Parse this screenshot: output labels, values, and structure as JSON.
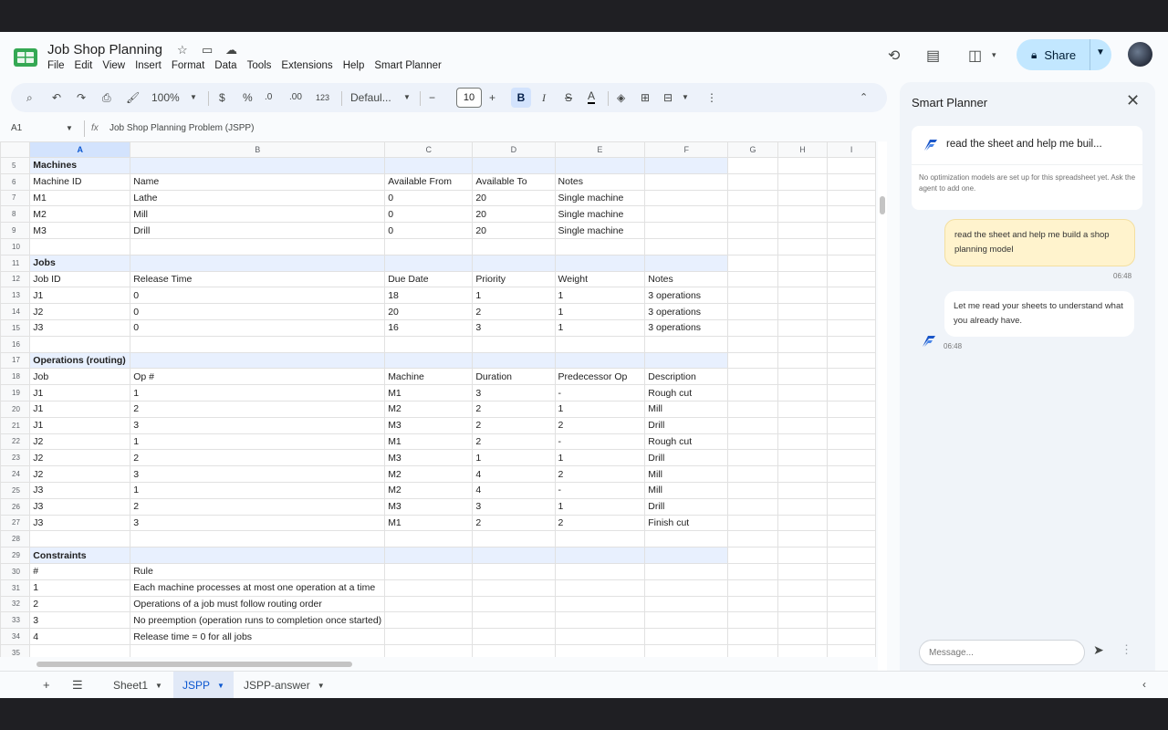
{
  "app": {
    "title": "Job Shop Planning",
    "menu": [
      "File",
      "Edit",
      "View",
      "Insert",
      "Format",
      "Data",
      "Tools",
      "Extensions",
      "Help",
      "Smart Planner"
    ],
    "share_label": "Share"
  },
  "toolbar": {
    "zoom": "100%",
    "currency": "$",
    "percent": "%",
    "dec_decrease": ".0",
    "dec_increase": ".00",
    "number_format": "123",
    "font": "Defaul...",
    "font_size": "10"
  },
  "formula_bar": {
    "cell_ref": "A1",
    "fx": "fx",
    "content": "Job Shop Planning Problem (JSPP)"
  },
  "grid": {
    "columns": [
      "A",
      "B",
      "C",
      "D",
      "E",
      "F",
      "G",
      "H",
      "I"
    ],
    "rows": [
      {
        "n": "5",
        "section": true,
        "cells": [
          "Machines",
          "",
          "",
          "",
          "",
          ""
        ]
      },
      {
        "n": "6",
        "cells": [
          "Machine ID",
          "Name",
          "Available From",
          "Available To",
          "Notes",
          ""
        ]
      },
      {
        "n": "7",
        "cells": [
          "M1",
          "Lathe",
          "0",
          "20",
          "Single machine",
          ""
        ]
      },
      {
        "n": "8",
        "cells": [
          "M2",
          "Mill",
          "0",
          "20",
          "Single machine",
          ""
        ]
      },
      {
        "n": "9",
        "cells": [
          "M3",
          "Drill",
          "0",
          "20",
          "Single machine",
          ""
        ]
      },
      {
        "n": "10",
        "cells": [
          "",
          "",
          "",
          "",
          "",
          ""
        ]
      },
      {
        "n": "11",
        "section": true,
        "cells": [
          "Jobs",
          "",
          "",
          "",
          "",
          ""
        ]
      },
      {
        "n": "12",
        "cells": [
          "Job ID",
          "Release Time",
          "Due Date",
          "Priority",
          "Weight",
          "Notes"
        ]
      },
      {
        "n": "13",
        "cells": [
          "J1",
          "0",
          "18",
          "1",
          "1",
          "3 operations"
        ]
      },
      {
        "n": "14",
        "cells": [
          "J2",
          "0",
          "20",
          "2",
          "1",
          "3 operations"
        ]
      },
      {
        "n": "15",
        "cells": [
          "J3",
          "0",
          "16",
          "3",
          "1",
          "3 operations"
        ]
      },
      {
        "n": "16",
        "cells": [
          "",
          "",
          "",
          "",
          "",
          ""
        ]
      },
      {
        "n": "17",
        "section": true,
        "cells": [
          "Operations (routing)",
          "",
          "",
          "",
          "",
          ""
        ]
      },
      {
        "n": "18",
        "cells": [
          "Job",
          "Op #",
          "Machine",
          "Duration",
          "Predecessor Op",
          "Description"
        ]
      },
      {
        "n": "19",
        "cells": [
          "J1",
          "1",
          "M1",
          "3",
          "-",
          "Rough cut"
        ]
      },
      {
        "n": "20",
        "cells": [
          "J1",
          "2",
          "M2",
          "2",
          "1",
          "Mill"
        ]
      },
      {
        "n": "21",
        "cells": [
          "J1",
          "3",
          "M3",
          "2",
          "2",
          "Drill"
        ]
      },
      {
        "n": "22",
        "cells": [
          "J2",
          "1",
          "M1",
          "2",
          "-",
          "Rough cut"
        ]
      },
      {
        "n": "23",
        "cells": [
          "J2",
          "2",
          "M3",
          "1",
          "1",
          "Drill"
        ]
      },
      {
        "n": "24",
        "cells": [
          "J2",
          "3",
          "M2",
          "4",
          "2",
          "Mill"
        ]
      },
      {
        "n": "25",
        "cells": [
          "J3",
          "1",
          "M2",
          "4",
          "-",
          "Mill"
        ]
      },
      {
        "n": "26",
        "cells": [
          "J3",
          "2",
          "M3",
          "3",
          "1",
          "Drill"
        ]
      },
      {
        "n": "27",
        "cells": [
          "J3",
          "3",
          "M1",
          "2",
          "2",
          "Finish cut"
        ]
      },
      {
        "n": "28",
        "cells": [
          "",
          "",
          "",
          "",
          "",
          ""
        ]
      },
      {
        "n": "29",
        "section": true,
        "cells": [
          "Constraints",
          "",
          "",
          "",
          "",
          ""
        ]
      },
      {
        "n": "30",
        "cells": [
          "#",
          "Rule",
          "",
          "",
          "",
          ""
        ]
      },
      {
        "n": "31",
        "cells": [
          "1",
          "Each machine processes at most one operation at a time",
          "",
          "",
          "",
          ""
        ]
      },
      {
        "n": "32",
        "cells": [
          "2",
          "Operations of a job must follow routing order",
          "",
          "",
          "",
          ""
        ]
      },
      {
        "n": "33",
        "cells": [
          "3",
          "No preemption (operation runs to completion once started)",
          "",
          "",
          "",
          ""
        ]
      },
      {
        "n": "34",
        "cells": [
          "4",
          "Release time = 0 for all jobs",
          "",
          "",
          "",
          ""
        ]
      },
      {
        "n": "35",
        "cells": [
          "",
          "",
          "",
          "",
          "",
          ""
        ]
      }
    ]
  },
  "sheets": {
    "tabs": [
      {
        "label": "Sheet1",
        "active": false
      },
      {
        "label": "JSPP",
        "active": true
      },
      {
        "label": "JSPP-answer",
        "active": false
      }
    ]
  },
  "panel": {
    "title": "Smart Planner",
    "task_title": "read the sheet and help me buil...",
    "task_note": "No optimization models are set up for this spreadsheet yet. Ask the agent to add one.",
    "messages": [
      {
        "role": "user",
        "text": "read the sheet and help me build a shop planning model",
        "time": "06:48"
      },
      {
        "role": "bot",
        "text": "Let me read your sheets to understand what you already have.",
        "time": "06:48"
      }
    ],
    "input_placeholder": "Message..."
  },
  "colors": {
    "accent": "#0b57d0",
    "share_bg": "#c2e7ff",
    "section_bg": "#e8f0fe",
    "user_bubble": "#fff3cd",
    "logo_green": "#34a853"
  }
}
